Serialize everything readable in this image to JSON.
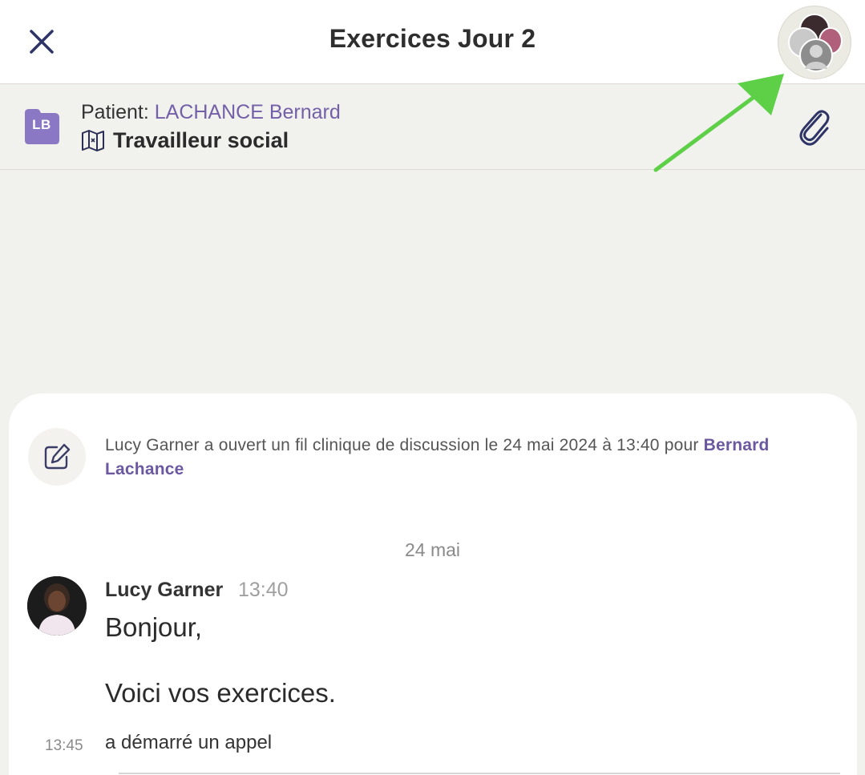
{
  "header": {
    "title": "Exercices Jour 2",
    "close_icon": "close-icon",
    "participants_icon": "participants-avatars"
  },
  "patient": {
    "initials": "LB",
    "label": "Patient:",
    "name": "LACHANCE Bernard",
    "role": "Travailleur social",
    "role_icon": "map-icon",
    "attach_icon": "paperclip-icon",
    "folder_color": "#8b78c4"
  },
  "thread": {
    "system_icon": "edit-icon",
    "system_text": "Lucy Garner a ouvert un fil clinique de discussion le 24 mai 2024 à 13:40 pour ",
    "system_patient": "Bernard Lachance",
    "date_separator": "24 mai",
    "messages": [
      {
        "author": "Lucy Garner",
        "time": "13:40",
        "lines": [
          "Bonjour,",
          "Voici vos exercices."
        ]
      }
    ],
    "call": {
      "time": "13:45",
      "text": "a démarré un appel"
    }
  },
  "colors": {
    "accent": "#6b58a1",
    "arrow": "#5dd048",
    "background": "#f1f1ed"
  }
}
